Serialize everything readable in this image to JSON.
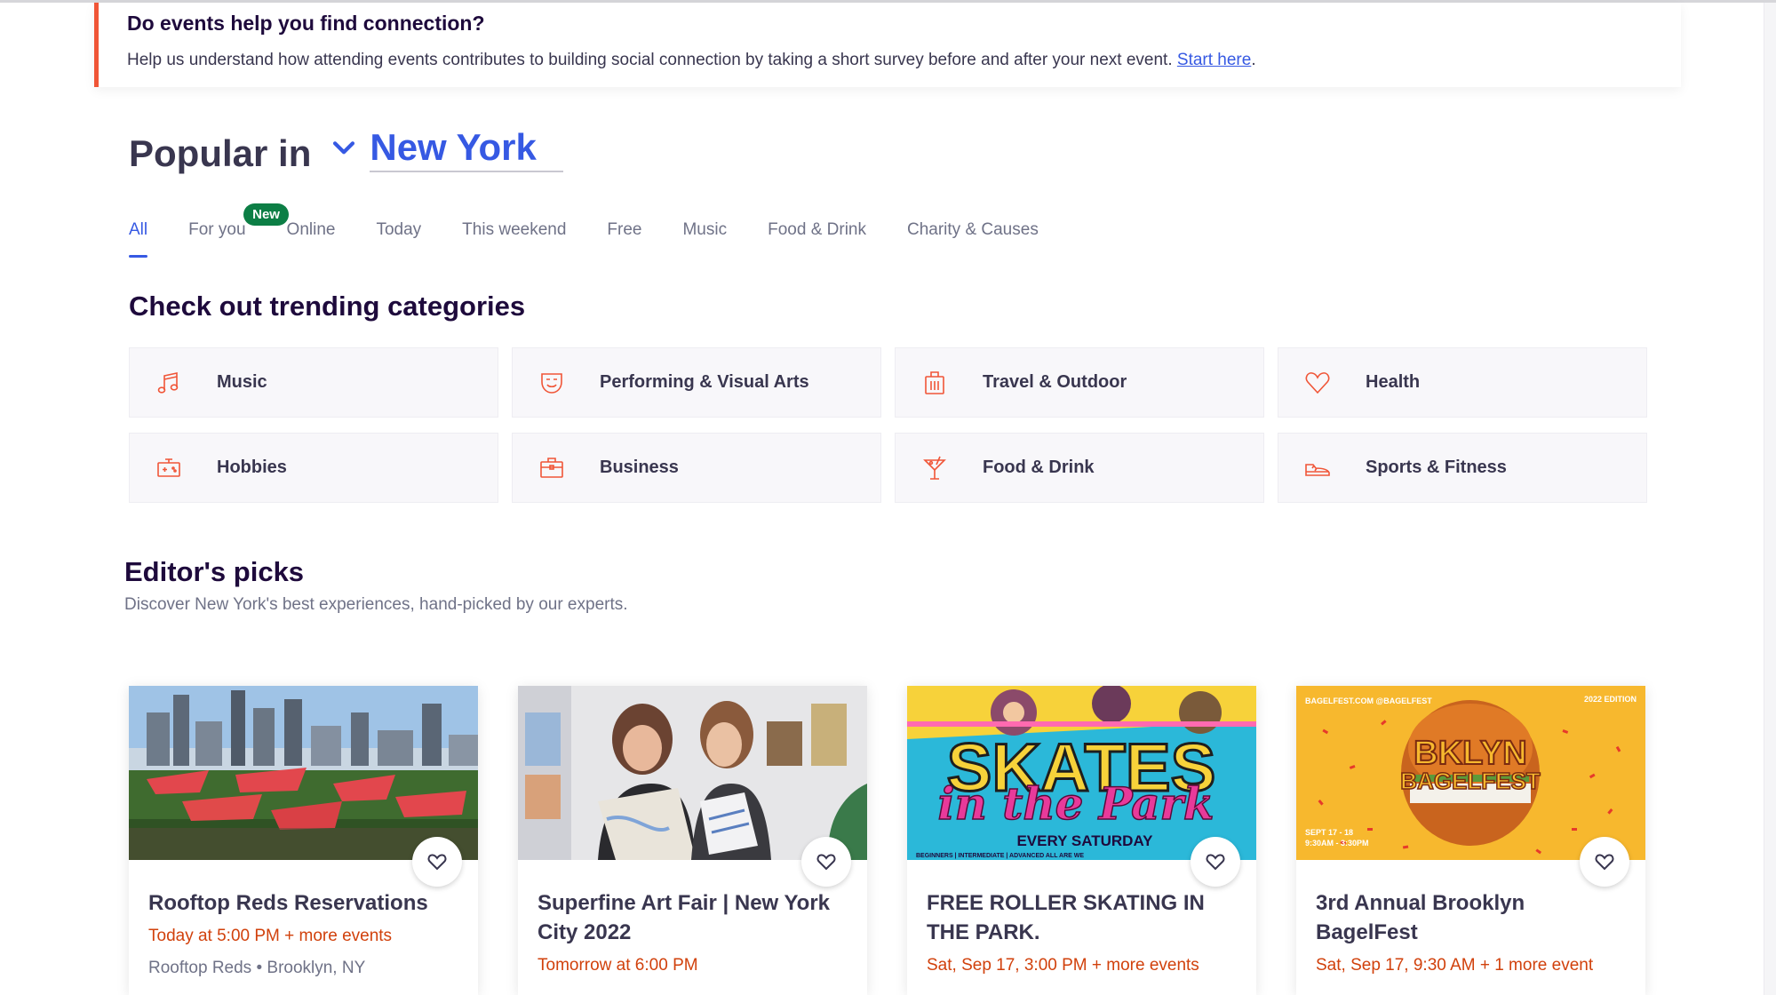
{
  "banner": {
    "title": "Do events help you find connection?",
    "text": "Help us understand how attending events contributes to building social connection by taking a short survey before and after your next event. ",
    "link": "Start here",
    "period": "."
  },
  "popular": {
    "label": "Popular in",
    "location": "New York"
  },
  "tabs": [
    {
      "label": "All",
      "active": true
    },
    {
      "label": "For you",
      "badge": "New"
    },
    {
      "label": "Online"
    },
    {
      "label": "Today"
    },
    {
      "label": "This weekend"
    },
    {
      "label": "Free"
    },
    {
      "label": "Music"
    },
    {
      "label": "Food & Drink"
    },
    {
      "label": "Charity & Causes"
    }
  ],
  "trending": {
    "title": "Check out trending categories",
    "categories": [
      {
        "label": "Music",
        "icon": "music-note-icon"
      },
      {
        "label": "Performing & Visual Arts",
        "icon": "theater-mask-icon"
      },
      {
        "label": "Travel & Outdoor",
        "icon": "luggage-icon"
      },
      {
        "label": "Health",
        "icon": "heart-icon"
      },
      {
        "label": "Hobbies",
        "icon": "game-controller-icon"
      },
      {
        "label": "Business",
        "icon": "briefcase-icon"
      },
      {
        "label": "Food & Drink",
        "icon": "cocktail-icon"
      },
      {
        "label": "Sports & Fitness",
        "icon": "sneaker-icon"
      }
    ]
  },
  "picks": {
    "title": "Editor's picks",
    "subtitle": "Discover New York's best experiences, hand-picked by our experts.",
    "cards": [
      {
        "title": "Rooftop Reds Reservations",
        "date": "Today at 5:00 PM + more events",
        "location": "Rooftop Reds • Brooklyn, NY"
      },
      {
        "title": "Superfine Art Fair | New York City 2022",
        "date": "Tomorrow at 6:00 PM",
        "location": ""
      },
      {
        "title": "FREE ROLLER SKATING IN THE PARK.",
        "date": "Sat, Sep 17, 3:00 PM + more events",
        "location": "",
        "image_text": {
          "big": "SKATES",
          "script": "in the Park",
          "sub": "EVERY SATURDAY",
          "tiny": "BEGINNERS | INTERMEDIATE | ADVANCED ALL ARE WE"
        }
      },
      {
        "title": "3rd Annual Brooklyn BagelFest",
        "date": "Sat, Sep 17, 9:30 AM + 1 more event",
        "location": "",
        "image_text": {
          "corner_left": "BAGELFEST.COM @BAGELFEST",
          "corner_right": "2022 EDITION",
          "line1": "BKLYN",
          "line2": "BAGELFEST",
          "dates": "SEPT 17 - 18",
          "hours": "9:30AM - 3:30PM"
        }
      }
    ]
  },
  "colors": {
    "accent": "#3659e3",
    "banner_stripe": "#f05537",
    "date": "#d1410c",
    "badge": "#0c7e45",
    "category_icon": "#f05537"
  }
}
